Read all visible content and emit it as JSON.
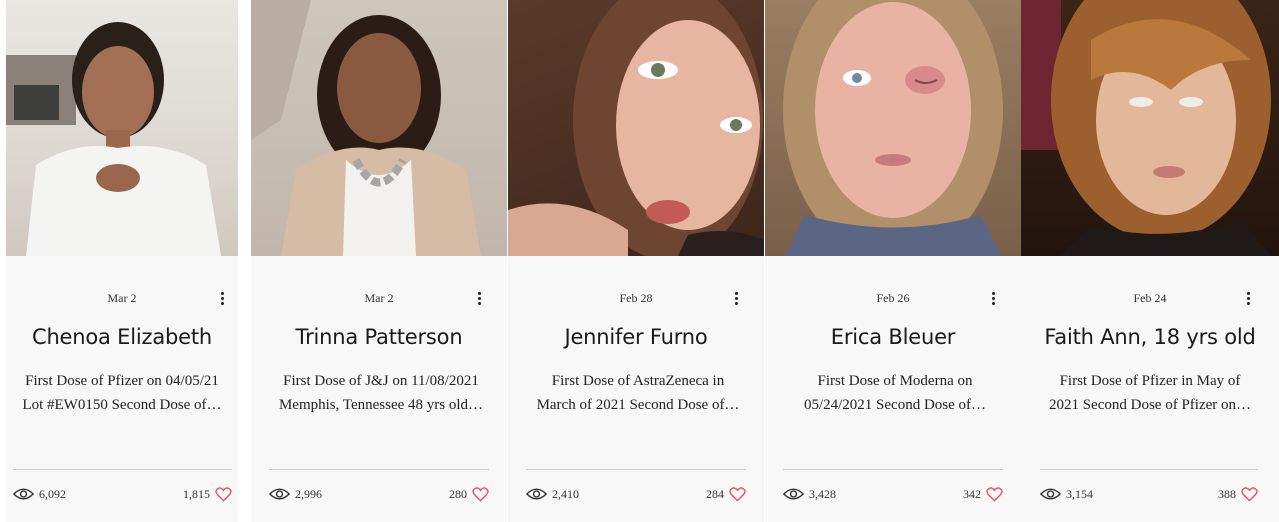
{
  "posts": [
    {
      "date": "Mar 2",
      "name": "Chenoa Elizabeth",
      "desc_line1": "First Dose of Pfizer on 04/05/21",
      "desc_line2": "Lot #EW0150 Second Dose of…",
      "views": "6,092",
      "likes": "1,815"
    },
    {
      "date": "Mar 2",
      "name": "Trinna Patterson",
      "desc_line1": "First Dose of J&J on 11/08/2021",
      "desc_line2": "Memphis, Tennessee 48 yrs old…",
      "views": "2,996",
      "likes": "280"
    },
    {
      "date": "Feb 28",
      "name": "Jennifer Furno",
      "desc_line1": "First Dose of AstraZeneca in",
      "desc_line2": "March of 2021 Second Dose of…",
      "views": "2,410",
      "likes": "284"
    },
    {
      "date": "Feb 26",
      "name": "Erica Bleuer",
      "desc_line1": "First Dose of Moderna on",
      "desc_line2": "05/24/2021 Second Dose of…",
      "views": "3,428",
      "likes": "342"
    },
    {
      "date": "Feb 24",
      "name": "Faith Ann, 18 yrs old",
      "desc_line1": "First Dose of Pfizer in May of",
      "desc_line2": "2021 Second Dose of Pfizer on…",
      "views": "3,154",
      "likes": "388"
    }
  ],
  "colors": {
    "heart": "#e8505b",
    "card_bg": "#f8f8f8",
    "divider": "#cfcfcf"
  },
  "icons": {
    "views": "eye-icon",
    "likes": "heart-icon",
    "menu": "more-vertical-icon"
  }
}
